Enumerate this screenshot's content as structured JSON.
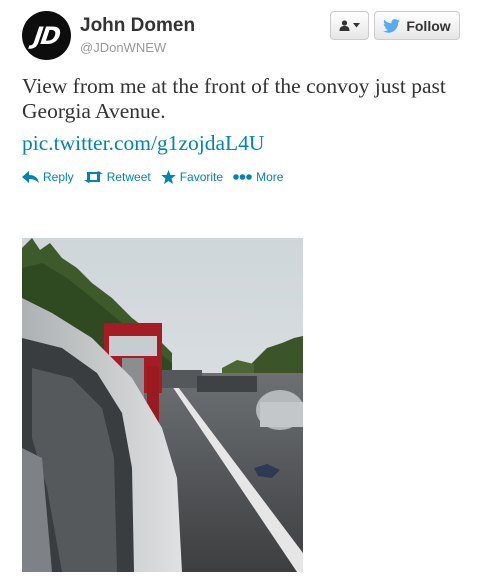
{
  "user": {
    "avatar_text": "JD",
    "full_name": "John Domen",
    "screen_name": "@JDonWNEW"
  },
  "header": {
    "follow_label": "Follow",
    "user_dropdown_icon": "person-caret-icon",
    "follow_icon": "twitter-bird-icon"
  },
  "tweet": {
    "text": "View from me at the front of the convoy just past Georgia Avenue.",
    "link": "pic.twitter.com/g1zojdaL4U"
  },
  "actions": [
    {
      "label": "Reply",
      "icon": "reply-arrow-icon"
    },
    {
      "label": "Retweet",
      "icon": "retweet-icon"
    },
    {
      "label": "Favorite",
      "icon": "star-icon"
    },
    {
      "label": "More",
      "icon": "more-dots-icon"
    }
  ],
  "colors": {
    "link": "#0084b4",
    "name": "#333333",
    "muted": "#999999",
    "twitter_bird": "#55acee"
  }
}
